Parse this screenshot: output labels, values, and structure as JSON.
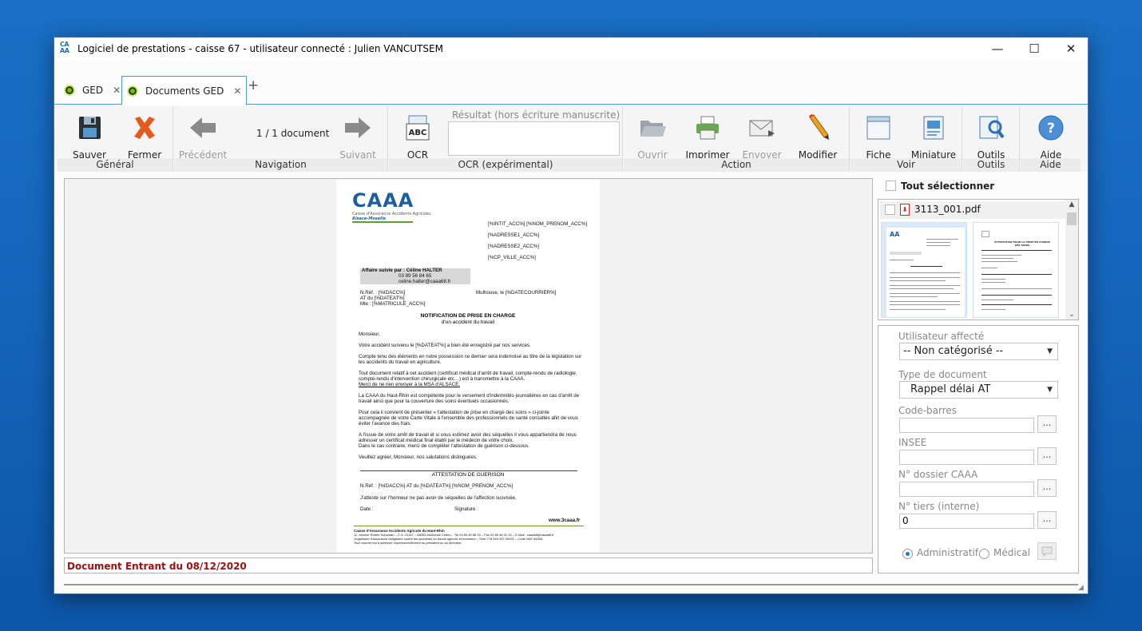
{
  "window": {
    "title": "Logiciel de prestations - caisse 67 - utilisateur connecté : Julien VANCUTSEM",
    "logo_top": "CA",
    "logo_bottom": "AA",
    "minimize": "—",
    "maximize": "☐",
    "close": "✕"
  },
  "tabs": [
    {
      "label": "GED",
      "close": "✕",
      "active": false
    },
    {
      "label": "Documents GED",
      "close": "✕",
      "active": true
    }
  ],
  "tab_add": "+",
  "ribbon": {
    "groups": {
      "general": "Général",
      "navigation": "Navigation",
      "ocr": "OCR (expérimental)",
      "action": "Action",
      "voir": "Voir",
      "outils": "Outils",
      "aide": "Aide"
    },
    "buttons": {
      "sauver": "Sauver",
      "fermer": "Fermer",
      "precedent": "Précédent",
      "suivant": "Suivant",
      "ocr": "OCR",
      "ouvrir": "Ouvrir",
      "imprimer": "Imprimer",
      "envoyer": "Envoyer",
      "modifier": "Modifier",
      "fiche": "Fiche",
      "miniature": "Miniature",
      "outils": "Outils",
      "aide": "Aide"
    },
    "nav_count": "1 / 1 document",
    "ocr_result_label": "Résultat (hors écriture manuscrite)",
    "ocr_icon_text": "ABC"
  },
  "document": {
    "logo": "CAAA",
    "logo_sub": "Caisse d'Assurance Accidents Agricoles",
    "logo_region": "Alsace-Moselle",
    "addr1": "[%INTIT_ACC%] [%NOM_PRENOM_ACC%]",
    "addr2": "[%ADRESSE1_ACC%]",
    "addr3": "[%ADRESSE2_ACC%]",
    "addr4": "[%CP_VILLE_ACC%]",
    "affaire": "Affaire suivie par :  Céline HALTER",
    "phone": "03 89 56 84 65",
    "email": "celine.halter@caaa68.fr",
    "ref1": "N.Réf. : [%IDACC%]",
    "ref2": "AT du [%DATEAT%]",
    "ref3": "Mle : [%MATRICULE_ACC%]",
    "date": "Mulhouse, le [%DATECOURRIER%]",
    "title1": "NOTIFICATION DE PRISE EN CHARGE",
    "title2": "d'un accident du travail",
    "salut": "Monsieur,",
    "p1": "Votre accident survenu le [%DATEAT%] a bien été enregistré par nos services.",
    "p2a": "Compte tenu des éléments en notre possession ce dernier sera indemnisé au titre de la législation sur",
    "p2b": "les accidents du travail en agriculture.",
    "p3a": "Tout document relatif à cet accident (certificat médical d'arrêt de travail, compte-rendu de radiologie,",
    "p3b": "compte-rendu d'intervention chirurgicale etc…) est à transmettre à la CAAA.",
    "p3c": "Merci de ne rien envoyer à la MSA d'ALSACE.",
    "p4a": "La CAAA du Haut-Rhin est compétente pour le versement d'indemnités journalières en cas d'arrêt de",
    "p4b": "travail ainsi que pour la couverture des soins éventuels occasionnés.",
    "p5a": "Pour cela il convient de présenter « l'attestation de prise en charge des soins » ci-jointe",
    "p5b": "accompagnée de votre Carte Vitale à l'ensemble des professionnels de santé consultés afin de vous",
    "p5c": "éviter l'avance des frais.",
    "p6a": "A l'issue de votre arrêt de travail et si vous estimez avoir des séquelles il vous appartiendra de nous",
    "p6b": "adresser un certificat médical final établi par le médecin de votre choix.",
    "p6c": "Dans le cas contraire, merci de compléter l'attestation de guérison ci-dessous.",
    "p7": "Veuillez agréer, Monsieur, nos salutations distinguées.",
    "att_title": "ATTESTATION DE GUERISON",
    "att_ref": "N.Réf. : [%IDACC%] AT du [%DATEAT%] [%NOM_PRENOM_ACC%]",
    "att_text": "J'atteste sur l'honneur ne pas avoir de séquelles de l'affection susvisée.",
    "att_date": "Date :",
    "att_sign": "Signature :",
    "site": "www.3caaa.fr",
    "footer1": "Caisse d'Assurance Accidents Agricole du Haut-Rhin",
    "footer2": "11, avenue Robert Schuman – C.S. 41167 – 68053 Mulhouse Cedex – Tel 03 89 45 68 22 – Fax 03 89 46 41 34 – E-Mail : caaa68@caaa68.fr",
    "footer3": "Organisme d'assurance obligatoire contre les accidents du travail agricole et forestiers – Siret 778 945 337 00021 – Code NAF 8430A",
    "footer4": "Tout courrier est à adresser impersonnellement au président ou au directeur."
  },
  "status_line": "Document Entrant du 08/12/2020",
  "right_panel": {
    "select_all": "Tout sélectionner",
    "file_name": "3113_001.pdf",
    "thumb2_title": "ATTESTATION POUR LA PRISE EN CHARGE DES SOINS"
  },
  "form": {
    "utilisateur_label": "Utilisateur affecté",
    "utilisateur_value": "-- Non catégorisé --",
    "type_label": "Type de document",
    "type_value": "Rappel délai AT",
    "codebarres_label": "Code-barres",
    "codebarres_value": "",
    "insee_label": "INSEE",
    "insee_value": "",
    "dossier_label": "N° dossier CAAA",
    "dossier_value": "",
    "tiers_label": "N° tiers (interne)",
    "tiers_value": "0",
    "browse": "...",
    "radio_admin": "Administratif",
    "radio_medical": "Médical"
  },
  "colors": {
    "desktop": "#1567bd",
    "accent": "#4d9bd0",
    "status_text": "#a01010",
    "tab_dot": "#7cb51c"
  },
  "icons": {
    "sauver": "floppy-disk-icon",
    "fermer": "red-x-icon",
    "precedent": "arrow-left-icon",
    "suivant": "arrow-right-icon",
    "ocr": "ocr-scan-icon",
    "ouvrir": "folder-icon",
    "imprimer": "printer-icon",
    "envoyer": "envelope-icon",
    "modifier": "pencil-icon",
    "fiche": "card-icon",
    "miniature": "thumbnail-icon",
    "outils": "tools-icon",
    "aide": "help-icon"
  }
}
